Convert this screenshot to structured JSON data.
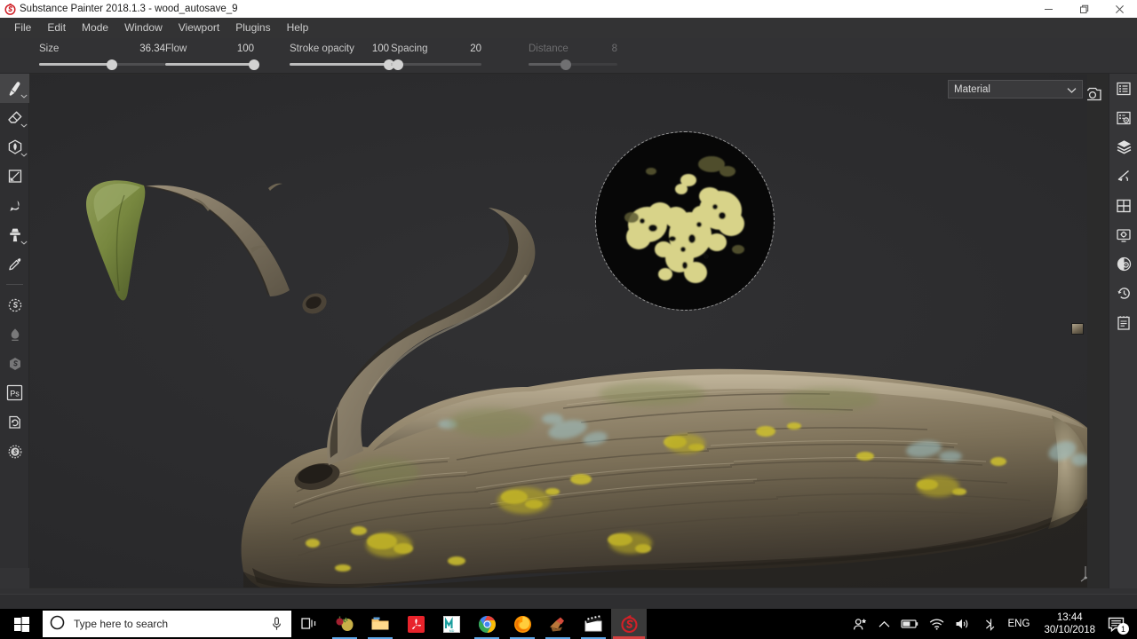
{
  "window": {
    "title": "Substance Painter 2018.1.3 - wood_autosave_9",
    "app_icon": "substance-painter-icon",
    "minimize": "minimize-icon",
    "restore": "restore-icon",
    "close": "close-icon"
  },
  "menubar": {
    "items": [
      {
        "label": "File"
      },
      {
        "label": "Edit"
      },
      {
        "label": "Mode"
      },
      {
        "label": "Window"
      },
      {
        "label": "Viewport"
      },
      {
        "label": "Plugins"
      },
      {
        "label": "Help"
      }
    ]
  },
  "toolbar": {
    "params": [
      {
        "name": "size",
        "label": "Size",
        "value": "36.34",
        "percent": 58,
        "disabled": false
      },
      {
        "name": "flow",
        "label": "Flow",
        "value": "100",
        "percent": 100,
        "disabled": false
      },
      {
        "name": "stroke_opacity",
        "label": "Stroke opacity",
        "value": "100",
        "percent": 100,
        "disabled": false
      },
      {
        "name": "spacing",
        "label": "Spacing",
        "value": "20",
        "percent": 5,
        "disabled": false
      },
      {
        "name": "distance",
        "label": "Distance",
        "value": "8",
        "percent": 38,
        "disabled": true
      }
    ],
    "icons": [
      {
        "name": "brush-tip-icon",
        "title": "Brush tip"
      },
      {
        "name": "stroke-curve-icon",
        "title": "Stroke"
      },
      {
        "name": "scatter-icon",
        "title": "Scatter"
      },
      {
        "name": "symmetry-icon",
        "title": "Symmetry"
      },
      {
        "name": "symmetry-plane-icon",
        "title": "Symmetry plane"
      },
      {
        "name": "tri-planar-icon",
        "title": "Tri-planar projection"
      },
      {
        "name": "uv-3d-toggle-icon",
        "title": "2D / 3D view"
      },
      {
        "name": "cube-display-icon",
        "title": "Shading / display"
      },
      {
        "name": "camera-view-icon",
        "title": "Camera"
      },
      {
        "name": "screenshot-icon",
        "title": "Take screenshot"
      }
    ]
  },
  "left_rail": {
    "tools": [
      {
        "name": "paint-brush-tool",
        "active": true,
        "caret": true,
        "dim": false
      },
      {
        "name": "eraser-tool",
        "active": false,
        "caret": true,
        "dim": false
      },
      {
        "name": "projection-tool",
        "active": false,
        "caret": true,
        "dim": false
      },
      {
        "name": "polygon-fill-tool",
        "active": false,
        "caret": false,
        "dim": false
      },
      {
        "name": "smudge-tool",
        "active": false,
        "caret": false,
        "dim": false
      },
      {
        "name": "clone-stamp-tool",
        "active": false,
        "caret": true,
        "dim": false
      },
      {
        "name": "eyedropper-tool",
        "active": false,
        "caret": false,
        "dim": false
      },
      {
        "name": "substance-bake-tool",
        "active": false,
        "caret": false,
        "dim": false
      },
      {
        "name": "particle-brush-tool",
        "active": false,
        "caret": false,
        "dim": true
      },
      {
        "name": "substance-source-tool",
        "active": false,
        "caret": false,
        "dim": true
      },
      {
        "name": "photoshop-plugin-tool",
        "active": false,
        "caret": false,
        "dim": false
      },
      {
        "name": "reload-resources-tool",
        "active": false,
        "caret": false,
        "dim": false
      },
      {
        "name": "substance-share-tool",
        "active": false,
        "caret": false,
        "dim": false
      }
    ]
  },
  "right_rail": {
    "panels": [
      {
        "name": "shelf-list-panel"
      },
      {
        "name": "texture-set-settings-panel"
      },
      {
        "name": "layers-panel"
      },
      {
        "name": "brush-properties-panel"
      },
      {
        "name": "texture-set-list-panel"
      },
      {
        "name": "display-settings-panel"
      },
      {
        "name": "shader-settings-panel"
      },
      {
        "name": "history-panel"
      },
      {
        "name": "log-panel"
      }
    ]
  },
  "viewport": {
    "material_dropdown": {
      "label": "Material",
      "caret": "chevron-down-icon"
    },
    "stencil": {
      "name": "lichen-stencil-preview"
    },
    "gizmo": {
      "name": "axis-gizmo"
    },
    "color_swatch": {
      "name": "material-color-swatch"
    }
  },
  "taskbar": {
    "start": "windows-start-icon",
    "search": {
      "placeholder": "Type here to search",
      "cortana_icon": "cortana-circle-icon",
      "mic_icon": "microphone-icon"
    },
    "task_view": "task-view-icon",
    "apps": [
      {
        "name": "taskbar-app-zbrush",
        "running": true,
        "active": false
      },
      {
        "name": "taskbar-app-file-explorer",
        "running": true,
        "active": false
      },
      {
        "name": "taskbar-app-acrobat",
        "running": false,
        "active": false
      },
      {
        "name": "taskbar-app-marvelous-designer",
        "running": false,
        "active": false
      },
      {
        "name": "taskbar-app-chrome",
        "running": true,
        "active": false
      },
      {
        "name": "taskbar-app-firefox",
        "running": true,
        "active": false
      },
      {
        "name": "taskbar-app-blender",
        "running": true,
        "active": false
      },
      {
        "name": "taskbar-app-movie-maker",
        "running": true,
        "active": false
      },
      {
        "name": "taskbar-app-substance-painter",
        "running": true,
        "active": true
      }
    ],
    "tray": {
      "people_icon": "people-icon",
      "chevron_icon": "show-hidden-icons-chevron",
      "battery_icon": "battery-icon",
      "network_icon": "wifi-icon",
      "volume_icon": "volume-icon",
      "pen_icon": "bluetooth-pen-icon",
      "language": "ENG",
      "time": "13:44",
      "date": "30/10/2018",
      "notifications_icon": "action-center-icon",
      "notifications_count": "1"
    }
  }
}
